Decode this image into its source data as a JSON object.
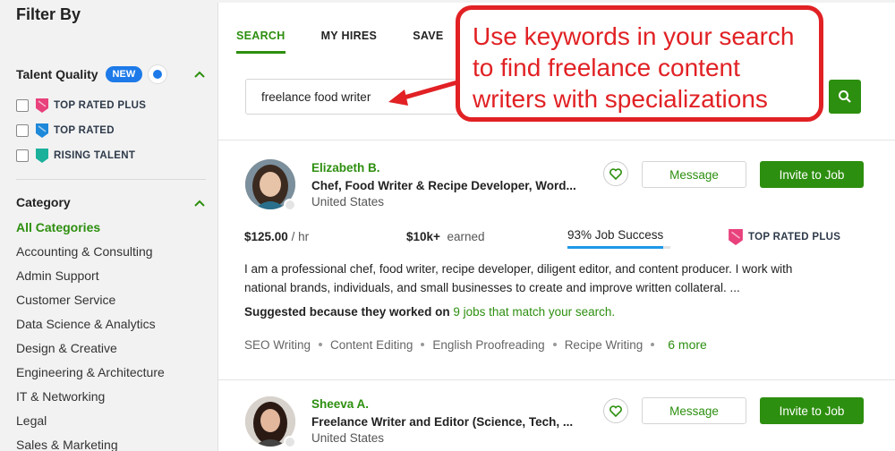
{
  "sidebar": {
    "filter_title": "Filter By",
    "talent_quality": {
      "label": "Talent Quality",
      "badge": "NEW",
      "options": [
        "TOP RATED PLUS",
        "TOP RATED",
        "RISING TALENT"
      ]
    },
    "category": {
      "label": "Category",
      "items": [
        "All Categories",
        "Accounting & Consulting",
        "Admin Support",
        "Customer Service",
        "Data Science & Analytics",
        "Design & Creative",
        "Engineering & Architecture",
        "IT & Networking",
        "Legal",
        "Sales & Marketing"
      ]
    }
  },
  "tabs": [
    "SEARCH",
    "MY HIRES",
    "SAVE"
  ],
  "search": {
    "value": "freelance food writer"
  },
  "callout": {
    "lines": [
      "Use keywords in your search",
      "to find freelance content",
      "writers with specializations"
    ]
  },
  "results": [
    {
      "name": "Elizabeth B.",
      "title": "Chef, Food Writer & Recipe Developer, Word...",
      "location": "United States",
      "message_label": "Message",
      "invite_label": "Invite to Job",
      "rate": "$125.00",
      "rate_unit": "/ hr",
      "earned": "$10k+",
      "earned_label": "earned",
      "job_success": "93% Job Success",
      "job_success_value": 0.93,
      "badge": "TOP RATED PLUS",
      "description_1": "I am a professional chef, food writer, recipe developer, diligent editor, and content producer. I work with",
      "description_2": "national brands, individuals, and small businesses to create and improve written collateral. ...",
      "suggest_prefix": "Suggested because they worked on",
      "suggest_link": "9 jobs that match your search.",
      "skills": [
        "SEO Writing",
        "Content Editing",
        "English Proofreading",
        "Recipe Writing"
      ],
      "more": "6 more"
    },
    {
      "name": "Sheeva A.",
      "title": "Freelance Writer and Editor (Science, Tech, ...",
      "location": "United States",
      "message_label": "Message",
      "invite_label": "Invite to Job"
    }
  ],
  "colors": {
    "brand_green": "#2d8f0f",
    "callout_red": "#e12124",
    "accent_blue": "#1d7ae8"
  }
}
